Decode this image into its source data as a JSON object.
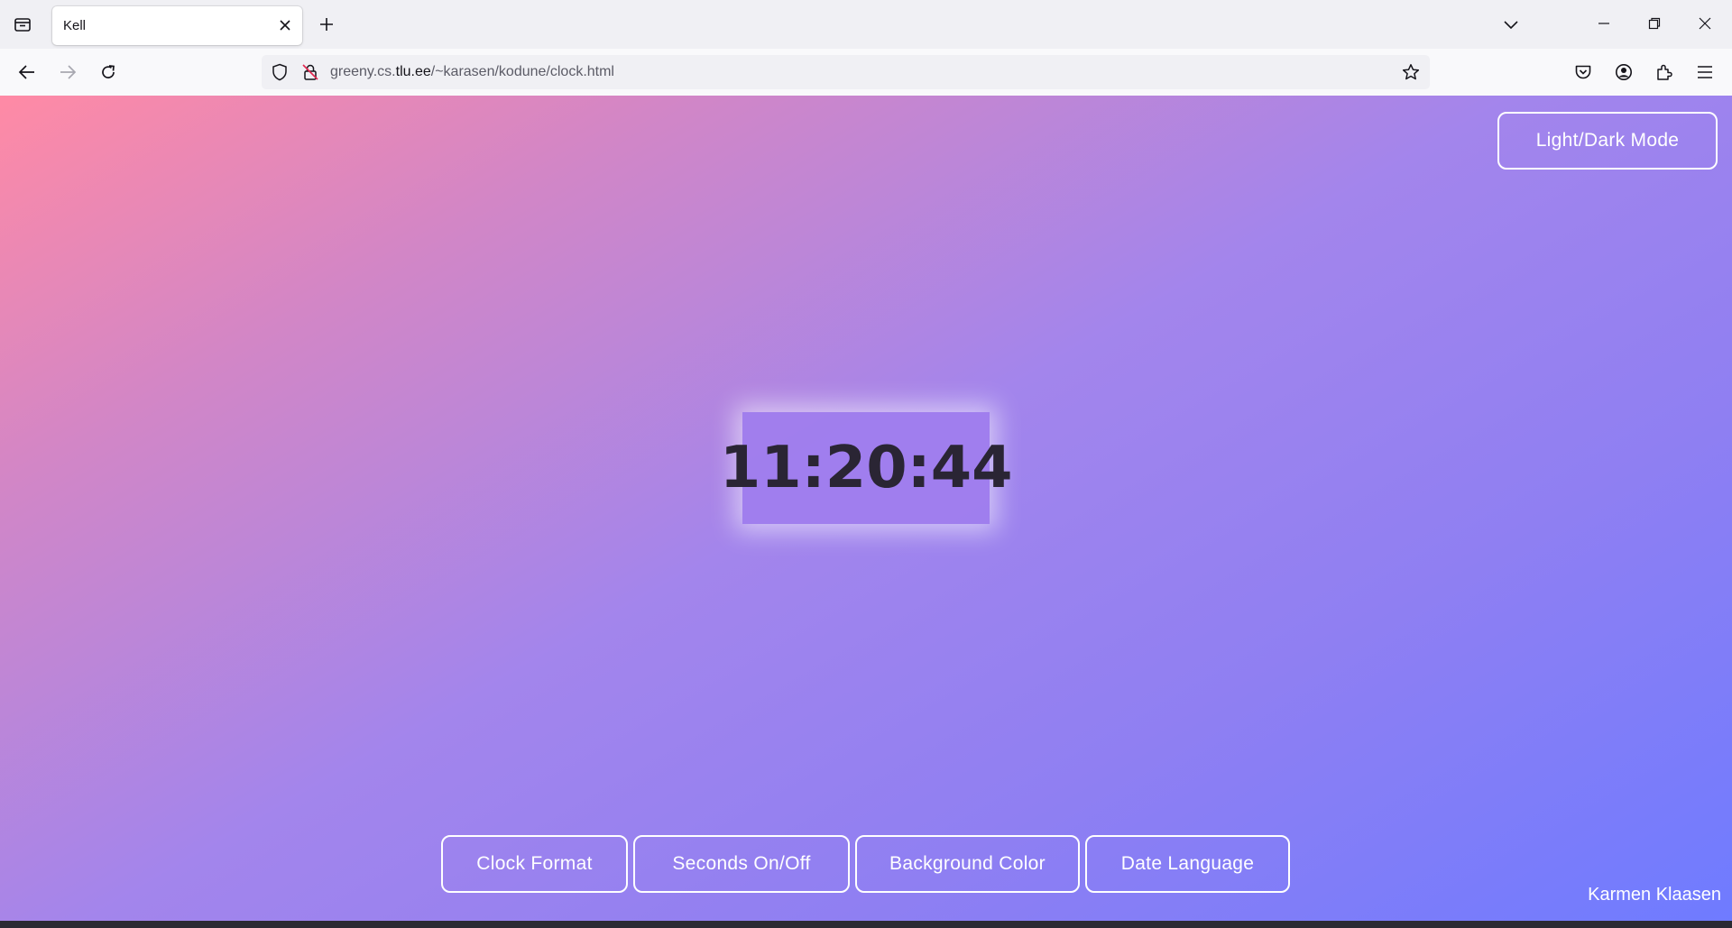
{
  "browser": {
    "tab": {
      "title": "Kell"
    },
    "url": {
      "prefix": "greeny.cs.",
      "host": "tlu.ee",
      "path": "/~karasen/kodune/clock.html"
    }
  },
  "page": {
    "mode_button": "Light/Dark Mode",
    "clock": {
      "time": "11:20:44"
    },
    "buttons": [
      {
        "label": "Clock Format"
      },
      {
        "label": "Seconds On/Off"
      },
      {
        "label": "Background Color"
      },
      {
        "label": "Date Language"
      }
    ],
    "author": "Karmen Klaasen"
  },
  "colors": {
    "gradient_start": "#ff8aa5",
    "gradient_mid": "#a385ec",
    "gradient_end": "#6f7bff",
    "clock_text": "#2a2534"
  },
  "icons": [
    "tab-list-icon",
    "close-icon",
    "plus-icon",
    "chevron-down-icon",
    "minimize-icon",
    "restore-icon",
    "window-close-icon",
    "back-arrow-icon",
    "forward-arrow-icon",
    "reload-icon",
    "shield-icon",
    "insecure-lock-icon",
    "star-icon",
    "pocket-icon",
    "account-icon",
    "extensions-icon",
    "menu-icon"
  ]
}
